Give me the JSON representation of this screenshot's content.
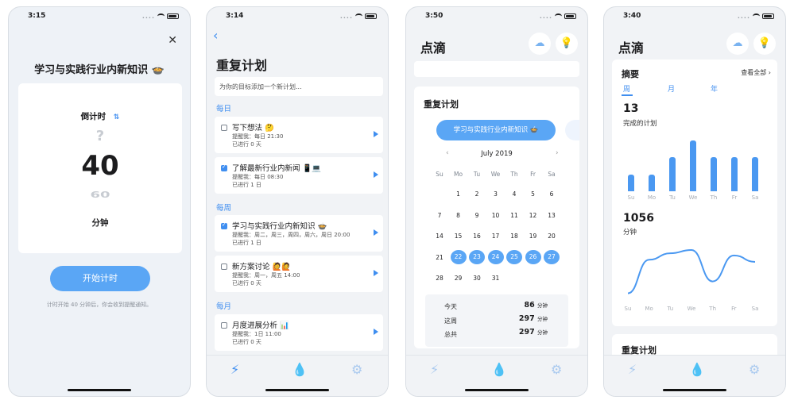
{
  "colors": {
    "accent": "#3f8ef0",
    "bar": "#4a98f1",
    "page_bg": "#f1f3f6"
  },
  "status_times": [
    "3:15",
    "3:14",
    "3:50",
    "3:40"
  ],
  "timer": {
    "title": "学习与实践行业内新知识 🍲",
    "mode_label": "倒计时",
    "value_above": "?",
    "value": "40",
    "value_below": "60",
    "unit": "分钟",
    "start_label": "开始计时",
    "hint": "计时开始 40 分钟后，你会收到提醒通知。"
  },
  "repeat": {
    "title": "重复计划",
    "add_placeholder": "为你的目标添加一个新计划...",
    "sections": {
      "daily": "每日",
      "weekly": "每周",
      "monthly": "每月"
    },
    "tasks": [
      {
        "title": "写下想法 🤔",
        "reminder": "提醒我：每日 21:30",
        "progress": "已进行 0 天",
        "checked": false
      },
      {
        "title": "了解最新行业内新闻 📱💻",
        "reminder": "提醒我：每日 08:30",
        "progress": "已进行 1 日",
        "checked": true
      },
      {
        "title": "学习与实践行业内新知识 🍲",
        "reminder": "提醒我：周二，周三，周四，周六，周日 20:00",
        "progress": "已进行 1 日",
        "checked": true
      },
      {
        "title": "新方案讨论 🙋🙋",
        "reminder": "提醒我：周一，周五 14:00",
        "progress": "已进行 0 天",
        "checked": false
      },
      {
        "title": "月度进展分析 📊",
        "reminder": "提醒我：1日 11:00",
        "progress": "已进行 0 天",
        "checked": false
      }
    ]
  },
  "calendar": {
    "app_title": "点滴",
    "section_title": "重复计划",
    "plan_chip": "学习与实践行业内新知识 🍲",
    "month": "July 2019",
    "prev": "‹",
    "next": "›",
    "dow": [
      "Su",
      "Mo",
      "Tu",
      "We",
      "Th",
      "Fr",
      "Sa"
    ],
    "weeks": [
      [
        "",
        "1",
        "2",
        "3",
        "4",
        "5",
        "6"
      ],
      [
        "7",
        "8",
        "9",
        "10",
        "11",
        "12",
        "13"
      ],
      [
        "14",
        "15",
        "16",
        "17",
        "18",
        "19",
        "20"
      ],
      [
        "21",
        "22",
        "23",
        "24",
        "25",
        "26",
        "27"
      ],
      [
        "28",
        "29",
        "30",
        "31",
        "",
        "",
        ""
      ]
    ],
    "selected_days": [
      "22",
      "23",
      "24",
      "25",
      "26",
      "27"
    ],
    "stats": [
      {
        "label": "今天",
        "value": "86",
        "unit": "分钟"
      },
      {
        "label": "这周",
        "value": "297",
        "unit": "分钟"
      },
      {
        "label": "总共",
        "value": "297",
        "unit": "分钟"
      }
    ]
  },
  "summary": {
    "app_title": "点滴",
    "title": "摘要",
    "view_all": "查看全部 ›",
    "segments": [
      "周",
      "月",
      "年"
    ],
    "completed_value": "13",
    "completed_label": "完成的计划",
    "minutes_value": "1056",
    "minutes_label": "分钟",
    "bottom_section": "重复计划",
    "days": [
      "Su",
      "Mo",
      "Tu",
      "We",
      "Th",
      "Fr",
      "Sa"
    ]
  },
  "icons": {
    "back": "chevron-left-icon",
    "close": "close-icon",
    "swap": "swap-icon",
    "cloud": "cloud-icon",
    "bulb": "lightbulb-icon",
    "tab_bolt": "bolt-icon",
    "tab_drop": "drop-icon",
    "tab_gear": "gear-icon"
  },
  "chart_data": [
    {
      "type": "bar",
      "categories": [
        "Su",
        "Mo",
        "Tu",
        "We",
        "Th",
        "Fr",
        "Sa"
      ],
      "values": [
        1,
        1,
        2,
        3,
        2,
        2,
        2
      ]
    },
    {
      "type": "line",
      "x": [
        "Su",
        "Mo",
        "Tu",
        "We",
        "Th",
        "Fr",
        "Sa"
      ],
      "values": [
        10,
        320,
        380,
        410,
        120,
        360,
        300
      ]
    }
  ]
}
